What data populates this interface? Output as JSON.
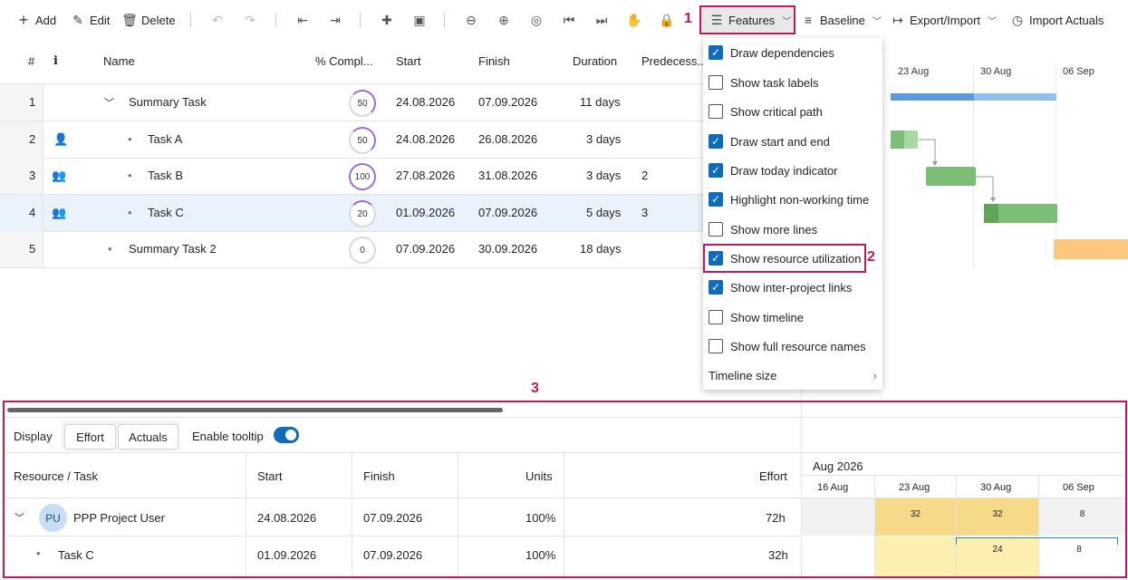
{
  "toolbar": {
    "add": "Add",
    "edit": "Edit",
    "delete": "Delete",
    "features": "Features",
    "baseline": "Baseline",
    "export_import": "Export/Import",
    "import_actuals": "Import Actuals"
  },
  "markers": {
    "m1": "1",
    "m2": "2",
    "m3": "3"
  },
  "grid": {
    "headers": {
      "num": "#",
      "info": "i",
      "name": "Name",
      "complete": "% Compl...",
      "start": "Start",
      "finish": "Finish",
      "duration": "Duration",
      "predecessors": "Predecess..."
    },
    "rows": [
      {
        "num": "1",
        "name": "Summary Task",
        "pct": "50",
        "start": "24.08.2026",
        "finish": "07.09.2026",
        "duration": "11 days",
        "pred": ""
      },
      {
        "num": "2",
        "name": "Task A",
        "pct": "50",
        "start": "24.08.2026",
        "finish": "26.08.2026",
        "duration": "3 days",
        "pred": ""
      },
      {
        "num": "3",
        "name": "Task B",
        "pct": "100",
        "start": "27.08.2026",
        "finish": "31.08.2026",
        "duration": "3 days",
        "pred": "2"
      },
      {
        "num": "4",
        "name": "Task C",
        "pct": "20",
        "start": "01.09.2026",
        "finish": "07.09.2026",
        "duration": "5 days",
        "pred": "3"
      },
      {
        "num": "5",
        "name": "Summary Task 2",
        "pct": "0",
        "start": "07.09.2026",
        "finish": "30.09.2026",
        "duration": "18 days",
        "pred": ""
      }
    ]
  },
  "gantt": {
    "dates": [
      "23 Aug",
      "30 Aug",
      "06 Sep"
    ]
  },
  "features_menu": {
    "items": [
      {
        "label": "Draw dependencies",
        "checked": true
      },
      {
        "label": "Show task labels",
        "checked": false
      },
      {
        "label": "Show critical path",
        "checked": false
      },
      {
        "label": "Draw start and end",
        "checked": true
      },
      {
        "label": "Draw today indicator",
        "checked": true
      },
      {
        "label": "Highlight non-working time",
        "checked": true
      },
      {
        "label": "Show more lines",
        "checked": false
      },
      {
        "label": "Show resource utilization",
        "checked": true
      },
      {
        "label": "Show inter-project links",
        "checked": true
      },
      {
        "label": "Show timeline",
        "checked": false
      },
      {
        "label": "Show full resource names",
        "checked": false
      }
    ],
    "timeline_size": "Timeline size"
  },
  "utilization": {
    "display": "Display",
    "effort": "Effort",
    "actuals": "Actuals",
    "enable_tooltip": "Enable tooltip",
    "headers": {
      "resource": "Resource / Task",
      "start": "Start",
      "finish": "Finish",
      "units": "Units",
      "effort": "Effort"
    },
    "month": "Aug 2026",
    "weeks": [
      "16 Aug",
      "23 Aug",
      "30 Aug",
      "06 Sep"
    ],
    "rows": [
      {
        "avatar": "PU",
        "name": "PPP Project User",
        "start": "24.08.2026",
        "finish": "07.09.2026",
        "units": "100%",
        "effort": "72h",
        "cells": [
          "",
          "32",
          "32",
          "8"
        ]
      },
      {
        "name": "Task C",
        "start": "01.09.2026",
        "finish": "07.09.2026",
        "units": "100%",
        "effort": "32h",
        "cells": [
          "",
          "",
          "24",
          "8"
        ]
      }
    ]
  }
}
